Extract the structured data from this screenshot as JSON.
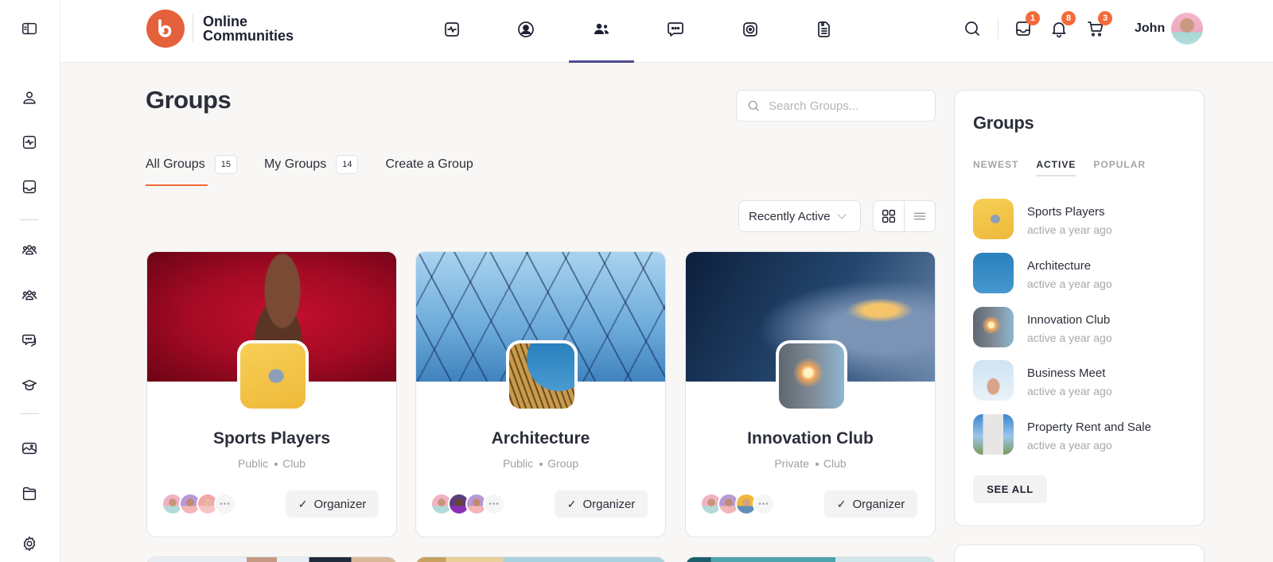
{
  "app": {
    "brand_line1": "Online",
    "brand_line2": "Communities",
    "accent_color": "#f06a35",
    "nav_active_color": "#4e4c8e"
  },
  "rail": {
    "items": [
      {
        "icon": "sidebar-toggle-icon"
      },
      {
        "icon": "profile-icon"
      },
      {
        "icon": "activity-icon"
      },
      {
        "icon": "inbox-icon"
      },
      {
        "icon": "groups-icon"
      },
      {
        "icon": "members-icon"
      },
      {
        "icon": "forums-icon"
      },
      {
        "icon": "courses-icon"
      },
      {
        "icon": "photos-icon"
      },
      {
        "icon": "documents-icon"
      },
      {
        "icon": "settings-icon"
      }
    ]
  },
  "header": {
    "nav": [
      {
        "icon": "activity-icon",
        "active": false
      },
      {
        "icon": "profile-icon",
        "active": false
      },
      {
        "icon": "groups-icon",
        "active": true
      },
      {
        "icon": "forums-icon",
        "active": false
      },
      {
        "icon": "videos-icon",
        "active": false
      },
      {
        "icon": "documents-icon",
        "active": false
      }
    ],
    "messages_badge": "1",
    "notifications_badge": "8",
    "cart_badge": "3",
    "user_name": "John"
  },
  "main": {
    "title": "Groups",
    "search_placeholder": "Search Groups...",
    "tabs": [
      {
        "label": "All Groups",
        "count": "15",
        "active": true
      },
      {
        "label": "My Groups",
        "count": "14",
        "active": false
      },
      {
        "label": "Create a Group",
        "count": null,
        "active": false
      }
    ],
    "sort_selected": "Recently Active",
    "view_mode": "grid",
    "groups": [
      {
        "name": "Sports Players",
        "privacy": "Public",
        "type": "Club",
        "role_button": "Organizer",
        "role_check": "✓"
      },
      {
        "name": "Architecture",
        "privacy": "Public",
        "type": "Group",
        "role_button": "Organizer",
        "role_check": "✓"
      },
      {
        "name": "Innovation Club",
        "privacy": "Private",
        "type": "Club",
        "role_button": "Organizer",
        "role_check": "✓"
      }
    ],
    "more_members": "•••"
  },
  "widget": {
    "title": "Groups",
    "tabs": [
      {
        "label": "NEWEST",
        "active": false
      },
      {
        "label": "ACTIVE",
        "active": true
      },
      {
        "label": "POPULAR",
        "active": false
      }
    ],
    "items": [
      {
        "name": "Sports Players",
        "time": "active a year ago"
      },
      {
        "name": "Architecture",
        "time": "active a year ago"
      },
      {
        "name": "Innovation Club",
        "time": "active a year ago"
      },
      {
        "name": "Business Meet",
        "time": "active a year ago"
      },
      {
        "name": "Property Rent and Sale",
        "time": "active a year ago"
      }
    ],
    "see_all": "SEE ALL"
  }
}
